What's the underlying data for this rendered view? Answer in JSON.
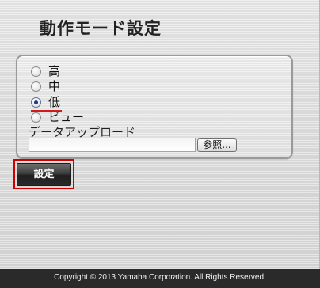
{
  "page": {
    "title": "動作モード設定"
  },
  "mode_options": [
    {
      "label": "高",
      "checked": false
    },
    {
      "label": "中",
      "checked": false
    },
    {
      "label": "低",
      "checked": true
    },
    {
      "label": "ビュー",
      "checked": false
    }
  ],
  "upload": {
    "label": "データアップロード",
    "file_value": "",
    "browse_label": "参照..."
  },
  "actions": {
    "set_label": "設定"
  },
  "footer": {
    "copyright": "Copyright © 2013 Yamaha Corporation. All Rights Reserved."
  },
  "colors": {
    "highlight": "#d00000",
    "footer_bg": "#2a2a2a",
    "button_dark": "#1e1e1e"
  }
}
